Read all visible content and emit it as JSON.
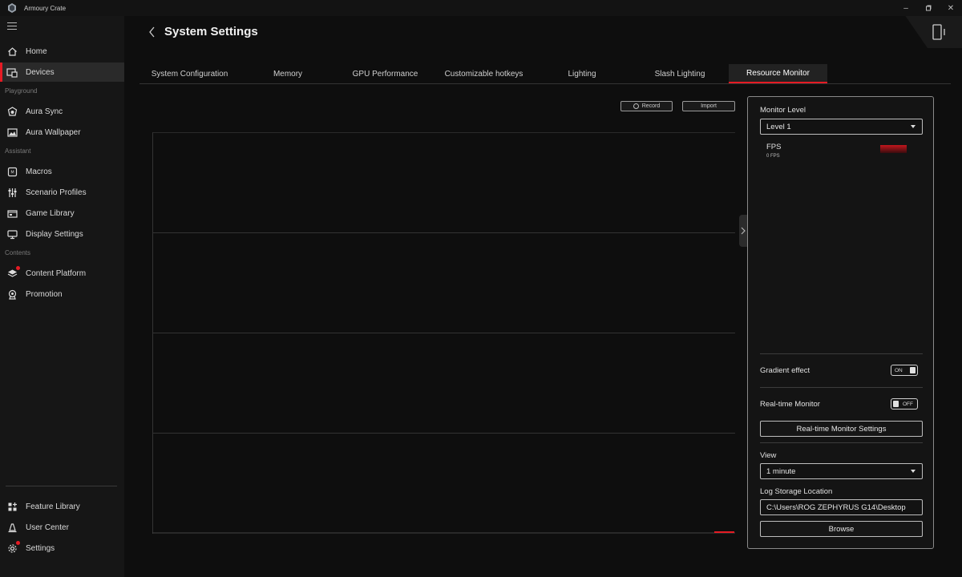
{
  "app": {
    "title": "Armoury Crate",
    "logo_icon": "rog-logo-icon",
    "minimize": "–",
    "restore": "▫",
    "close": "✕"
  },
  "sidebar": {
    "items": [
      {
        "label": "Home",
        "icon": "home-icon"
      },
      {
        "label": "Devices",
        "icon": "devices-icon",
        "active": true
      },
      {
        "label": "Aura Sync",
        "icon": "aura-sync-icon"
      },
      {
        "label": "Aura Wallpaper",
        "icon": "wallpaper-icon"
      },
      {
        "label": "Macros",
        "icon": "macros-icon"
      },
      {
        "label": "Scenario Profiles",
        "icon": "sliders-icon"
      },
      {
        "label": "Game Library",
        "icon": "game-library-icon"
      },
      {
        "label": "Display Settings",
        "icon": "display-icon"
      },
      {
        "label": "Content Platform",
        "icon": "content-platform-icon",
        "badge": true
      },
      {
        "label": "Promotion",
        "icon": "promotion-icon"
      }
    ],
    "sections": {
      "playground": "Playground",
      "assistant": "Assistant",
      "contents": "Contents"
    },
    "bottom": [
      {
        "label": "Feature Library",
        "icon": "feature-library-icon"
      },
      {
        "label": "User Center",
        "icon": "user-center-icon"
      },
      {
        "label": "Settings",
        "icon": "settings-gear-icon",
        "badge": true
      }
    ]
  },
  "header": {
    "title": "System Settings"
  },
  "tabs": [
    {
      "label": "System Configuration"
    },
    {
      "label": "Memory"
    },
    {
      "label": "GPU Performance"
    },
    {
      "label": "Customizable hotkeys"
    },
    {
      "label": "Lighting"
    },
    {
      "label": "Slash Lighting"
    },
    {
      "label": "Resource Monitor",
      "active": true
    }
  ],
  "toolbar": {
    "record_label": "Record",
    "import_label": "Import"
  },
  "panel": {
    "monitor_level_label": "Monitor Level",
    "monitor_level_value": "Level 1",
    "metric_name": "FPS",
    "metric_value": "0 FPS",
    "metric_color": "#c2161d",
    "gradient_label": "Gradient effect",
    "gradient_state": "ON",
    "realtime_label": "Real-time Monitor",
    "realtime_state": "OFF",
    "realtime_settings_button": "Real-time Monitor Settings",
    "view_label": "View",
    "view_value": "1 minute",
    "log_label": "Log Storage Location",
    "log_path": "C:\\Users\\ROG ZEPHYRUS G14\\Desktop",
    "browse_button": "Browse"
  },
  "colors": {
    "accent": "#e51b24",
    "background": "#0e0e0e",
    "sidebar": "#161616"
  }
}
